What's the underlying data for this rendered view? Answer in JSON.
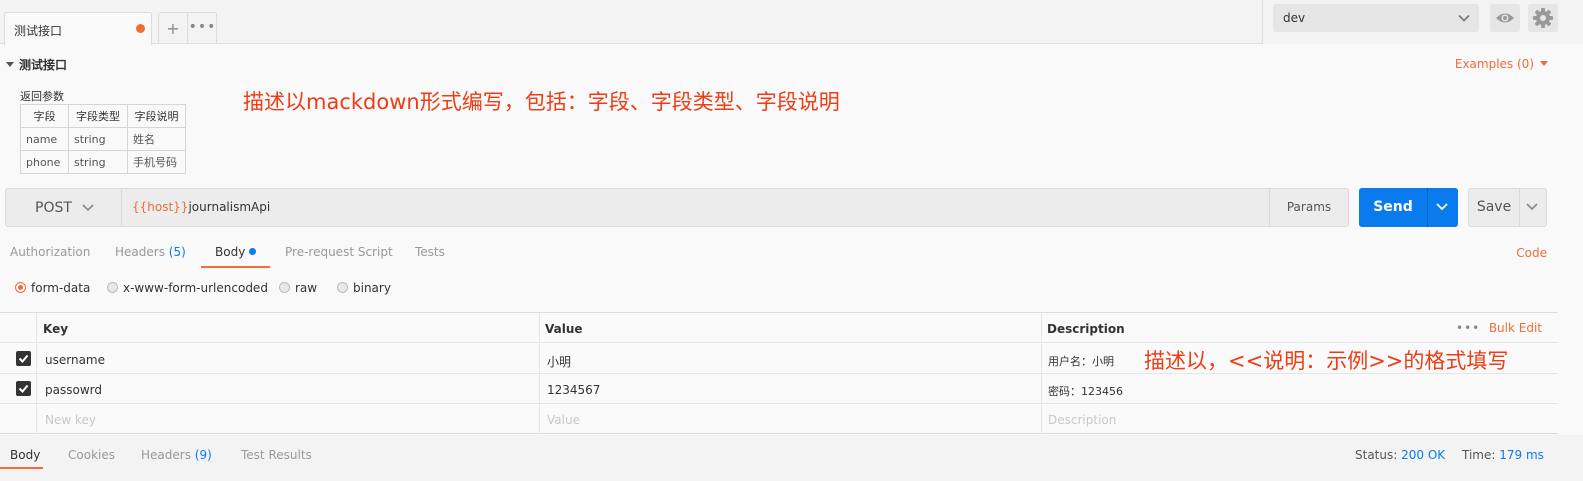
{
  "tabs": {
    "active_title": "测试接口",
    "add_label": "+",
    "more_label": "•••"
  },
  "environment": {
    "selected": "dev"
  },
  "request": {
    "name": "测试接口",
    "examples_label": "Examples (0)",
    "description": {
      "title": "返回参数",
      "headers": [
        "字段",
        "字段类型",
        "字段说明"
      ],
      "rows": [
        [
          "name",
          "string",
          "姓名"
        ],
        [
          "phone",
          "string",
          "手机号码"
        ]
      ]
    },
    "method": "POST",
    "url_var": "{{host}}",
    "url_path": "journalismApi",
    "params_label": "Params",
    "send_label": "Send",
    "save_label": "Save"
  },
  "annotations": {
    "top": "描述以mackdown形式编写，包括：字段、字段类型、字段说明",
    "right": "描述以，<<说明：示例>>的格式填写"
  },
  "request_tabs": {
    "authorization": "Authorization",
    "headers": "Headers",
    "headers_count": "(5)",
    "body": "Body",
    "prerequest": "Pre-request Script",
    "tests": "Tests",
    "code": "Code"
  },
  "body_types": {
    "form_data": "form-data",
    "urlencoded": "x-www-form-urlencoded",
    "raw": "raw",
    "binary": "binary"
  },
  "kv_table": {
    "headers": {
      "key": "Key",
      "value": "Value",
      "description": "Description"
    },
    "more_label": "•••",
    "bulk_edit": "Bulk Edit",
    "rows": [
      {
        "key": "username",
        "value": "小明",
        "description": "用户名：小明"
      },
      {
        "key": "passowrd",
        "value": "1234567",
        "description": "密码：123456"
      }
    ],
    "placeholders": {
      "key": "New key",
      "value": "Value",
      "description": "Description"
    }
  },
  "response": {
    "tabs": {
      "body": "Body",
      "cookies": "Cookies",
      "headers": "Headers",
      "headers_count": "(9)",
      "test_results": "Test Results"
    },
    "status_label": "Status:",
    "status_value": "200 OK",
    "time_label": "Time:",
    "time_value": "179 ms"
  },
  "colors": {
    "accent": "#f26b3a",
    "primary": "#097bed",
    "annotation": "#ee3c14"
  }
}
